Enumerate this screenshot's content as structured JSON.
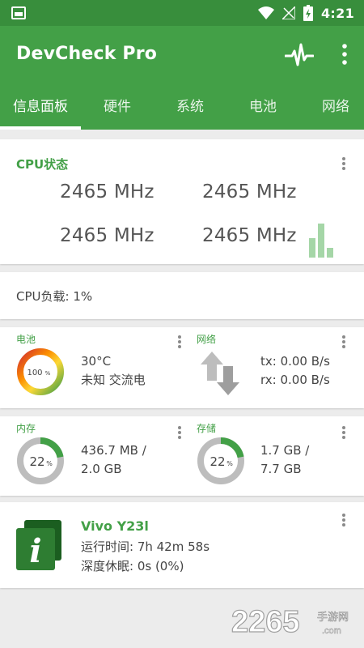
{
  "status_bar": {
    "time": "4:21"
  },
  "app_bar": {
    "title": "DevCheck Pro"
  },
  "tabs": [
    {
      "label": "信息面板",
      "active": true
    },
    {
      "label": "硬件",
      "active": false
    },
    {
      "label": "系统",
      "active": false
    },
    {
      "label": "电池",
      "active": false
    },
    {
      "label": "网络",
      "active": false
    }
  ],
  "cpu": {
    "title": "CPU状态",
    "freqs": [
      "2465 MHz",
      "2465 MHz",
      "2465 MHz",
      "2465 MHz"
    ]
  },
  "cpu_load": {
    "label": "CPU负载: 1%"
  },
  "battery": {
    "title": "电池",
    "percent": "100",
    "percent_sign": "%",
    "temp": "30°C",
    "status": "未知 交流电",
    "level": 1.0
  },
  "network": {
    "title": "网络",
    "tx": "tx: 0.00 B/s",
    "rx": "rx: 0.00 B/s"
  },
  "memory": {
    "title": "内存",
    "percent": "22",
    "percent_sign": "%",
    "used": "436.7 MB /",
    "total": "2.0 GB",
    "fraction": 0.22
  },
  "storage": {
    "title": "存储",
    "percent": "22",
    "percent_sign": "%",
    "used": "1.7 GB /",
    "total": "7.7 GB",
    "fraction": 0.22
  },
  "device": {
    "name": "Vivo Y23l",
    "uptime": "运行时间: 7h 42m 58s",
    "deep_sleep": "深度休眠: 0s (0%)",
    "icon_letter": "i"
  },
  "watermark": {
    "number": "2265",
    "suffix": "手游网",
    "domain": ".com"
  },
  "colors": {
    "primary": "#43a047",
    "primary_dark": "#388e3c",
    "donut_track": "#bdbdbd",
    "battery_gradient": [
      "#d32f2f",
      "#fb8c00",
      "#fdd835",
      "#43a047"
    ]
  }
}
